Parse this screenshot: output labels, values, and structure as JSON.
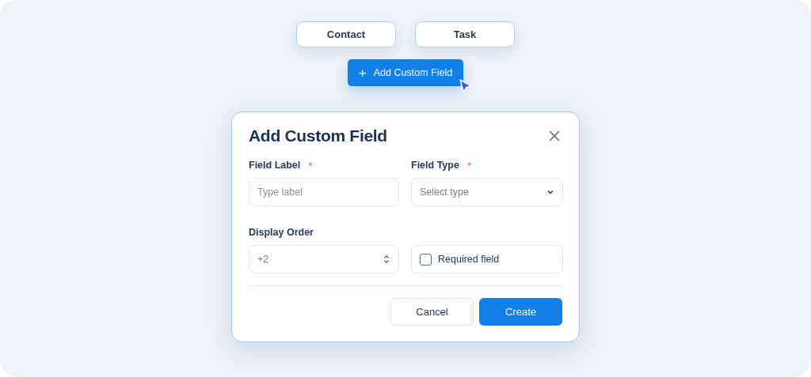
{
  "type_buttons": [
    {
      "label": "Contact"
    },
    {
      "label": "Task"
    }
  ],
  "add_button": {
    "icon": "+",
    "label": "Add Custom Field"
  },
  "dialog": {
    "title": "Add Custom Field",
    "fields": [
      {
        "kind": "text",
        "label": "Field Label",
        "required_mark": "*",
        "placeholder": "Type label"
      },
      {
        "kind": "select",
        "label": "Field Type",
        "required_mark": "*",
        "placeholder": "Select type"
      },
      {
        "kind": "number",
        "label": "Display Order",
        "value": "+2"
      },
      {
        "kind": "checkbox",
        "label": "Required field",
        "checked": false
      }
    ],
    "buttons": [
      {
        "kind": "secondary",
        "label": "Cancel"
      },
      {
        "kind": "primary",
        "label": "Create"
      }
    ]
  }
}
